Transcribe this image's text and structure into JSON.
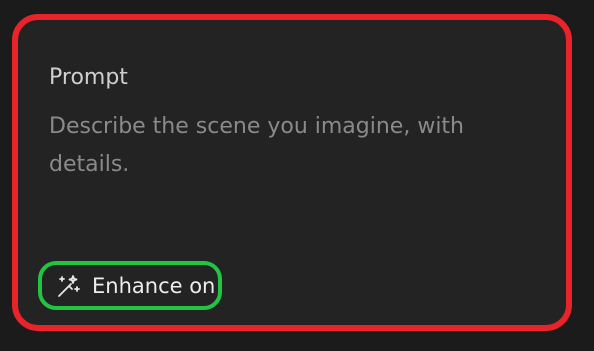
{
  "prompt": {
    "label": "Prompt",
    "placeholder": "Describe the scene you imagine, with details.",
    "value": ""
  },
  "enhance": {
    "label": "Enhance on",
    "icon": "magic-wand-icon",
    "state": "on"
  },
  "colors": {
    "card_border": "#e8232a",
    "enhance_border": "#22c443",
    "card_background": "#232323",
    "page_background": "#1b1b1b"
  }
}
